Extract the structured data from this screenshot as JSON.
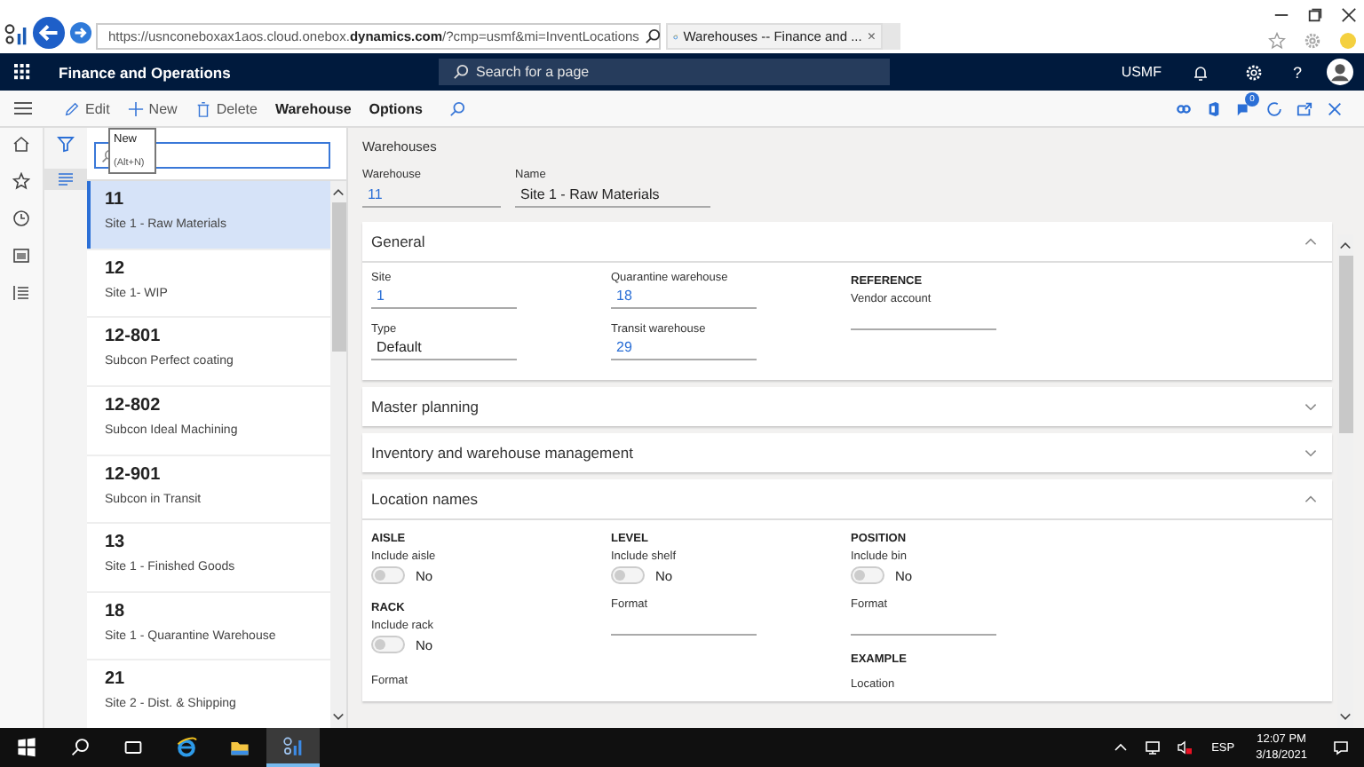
{
  "browser": {
    "url_prefix": "https://usnconeboxax1aos.cloud.onebox.",
    "url_domain": "dynamics.com",
    "url_suffix": "/?cmp=usmf&mi=InventLocations",
    "tab_title": "Warehouses -- Finance and ...",
    "tab_close": "×"
  },
  "app": {
    "title": "Finance and Operations",
    "search_placeholder": "Search for a page",
    "company": "USMF",
    "help": "?"
  },
  "action_bar": {
    "buttons": [
      {
        "label": "Edit",
        "kind": "edit"
      },
      {
        "label": "New",
        "kind": "new"
      },
      {
        "label": "Delete",
        "kind": "delete"
      },
      {
        "label": "Warehouse",
        "kind": "plain"
      },
      {
        "label": "Options",
        "kind": "plain"
      }
    ],
    "badge": "0"
  },
  "tooltip": {
    "title": "New",
    "shortcut": "(Alt+N)"
  },
  "list": {
    "items": [
      {
        "id": "11",
        "name": "Site 1 - Raw Materials",
        "selected": true
      },
      {
        "id": "12",
        "name": "Site 1- WIP",
        "selected": false
      },
      {
        "id": "12-801",
        "name": "Subcon Perfect coating",
        "selected": false
      },
      {
        "id": "12-802",
        "name": "Subcon Ideal Machining",
        "selected": false
      },
      {
        "id": "12-901",
        "name": "Subcon in Transit",
        "selected": false
      },
      {
        "id": "13",
        "name": "Site 1 - Finished Goods",
        "selected": false
      },
      {
        "id": "18",
        "name": "Site 1 - Quarantine Warehouse",
        "selected": false
      },
      {
        "id": "21",
        "name": "Site 2 - Dist. & Shipping",
        "selected": false
      }
    ]
  },
  "header": {
    "caption": "Warehouses",
    "fields": [
      {
        "label": "Warehouse",
        "value": "11",
        "kind": "link"
      },
      {
        "label": "Name",
        "value": "Site 1 - Raw Materials",
        "kind": "text"
      }
    ]
  },
  "sections": [
    {
      "title": "General",
      "expanded": true,
      "columns": [
        {
          "items": [
            {
              "kind": "field",
              "label": "Site",
              "value": "1",
              "link": true
            },
            {
              "kind": "field",
              "label": "Type",
              "value": "Default",
              "link": false
            }
          ]
        },
        {
          "items": [
            {
              "kind": "field",
              "label": "Quarantine warehouse",
              "value": "18",
              "link": true
            },
            {
              "kind": "field",
              "label": "Transit warehouse",
              "value": "29",
              "link": true
            }
          ]
        },
        {
          "items": [
            {
              "kind": "heading",
              "label": "REFERENCE"
            },
            {
              "kind": "field",
              "label": "Vendor account"
            }
          ]
        }
      ]
    },
    {
      "title": "Master planning",
      "expanded": false
    },
    {
      "title": "Inventory and warehouse management",
      "expanded": false
    },
    {
      "title": "Location names",
      "expanded": true,
      "columns": [
        {
          "items": [
            {
              "kind": "heading",
              "label": "AISLE"
            },
            {
              "kind": "toggle",
              "label": "Include aisle",
              "on": false,
              "state_text": "No"
            },
            {
              "kind": "heading",
              "label": "RACK"
            },
            {
              "kind": "toggle",
              "label": "Include rack",
              "on": false,
              "state_text": "No"
            },
            {
              "kind": "caption",
              "label": "Format"
            }
          ]
        },
        {
          "items": [
            {
              "kind": "heading",
              "label": "LEVEL"
            },
            {
              "kind": "toggle",
              "label": "Include shelf",
              "on": false,
              "state_text": "No"
            },
            {
              "kind": "field",
              "label": "Format"
            }
          ]
        },
        {
          "items": [
            {
              "kind": "heading",
              "label": "POSITION"
            },
            {
              "kind": "toggle",
              "label": "Include bin",
              "on": false,
              "state_text": "No"
            },
            {
              "kind": "field",
              "label": "Format"
            },
            {
              "kind": "heading",
              "label": "EXAMPLE"
            },
            {
              "kind": "caption",
              "label": "Location"
            }
          ]
        }
      ]
    }
  ],
  "taskbar": {
    "language": "ESP",
    "time": "12:07 PM",
    "date": "3/18/2021"
  }
}
